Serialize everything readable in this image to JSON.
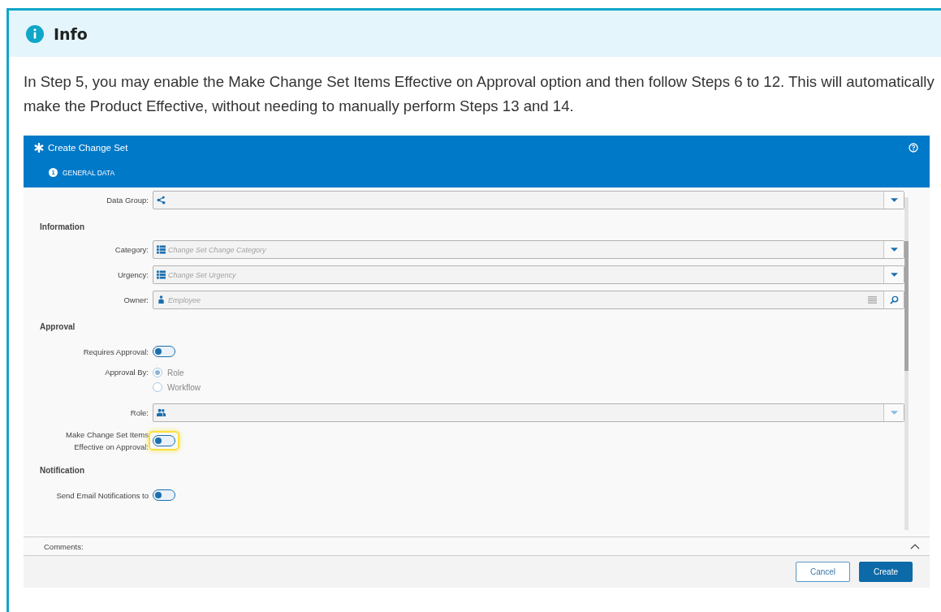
{
  "info": {
    "title": "Info",
    "text": "In Step 5, you may enable the Make Change Set Items Effective on Approval option and then follow Steps 6 to 12. This will automatically make the Product Effective, without needing to manually perform Steps 13 and 14."
  },
  "dialog": {
    "title": "Create Change Set",
    "steps": [
      {
        "number": "1",
        "label": "GENERAL DATA",
        "selected": true
      }
    ],
    "rows": [
      {
        "kind": "select",
        "label": "Data Group:",
        "disabled": false
      },
      {
        "kind": "section",
        "label": "Information"
      },
      {
        "kind": "select",
        "label": "Category:",
        "placeholder": "Change Set Change Category",
        "disabled": false
      },
      {
        "kind": "select",
        "label": "Urgency:",
        "placeholder": "Change Set Urgency",
        "disabled": false
      },
      {
        "kind": "lookup",
        "label": "Owner:",
        "placeholder": "Employee"
      },
      {
        "kind": "section",
        "label": "Approval"
      },
      {
        "kind": "toggle",
        "label": "Requires Approval:",
        "on": false,
        "highlighted": false
      },
      {
        "kind": "radio",
        "label": "Approval By:",
        "disabled": true,
        "options": [
          {
            "label": "Role",
            "selected": true
          },
          {
            "label": "Workflow",
            "selected": false
          }
        ]
      },
      {
        "kind": "select",
        "label": "Role:",
        "disabled": true
      },
      {
        "kind": "toggle",
        "label": "Make Change Set Items Effective on Approval:",
        "on": false,
        "highlighted": true
      },
      {
        "kind": "section",
        "label": "Notification"
      },
      {
        "kind": "toggle",
        "label": "Send Email Notifications to",
        "on": false,
        "highlighted": false
      }
    ],
    "comments": {
      "label": "Comments:",
      "expanded": false
    },
    "buttons": [
      {
        "kind": "secondary",
        "label": "Cancel"
      },
      {
        "kind": "primary",
        "label": "Create"
      }
    ]
  }
}
